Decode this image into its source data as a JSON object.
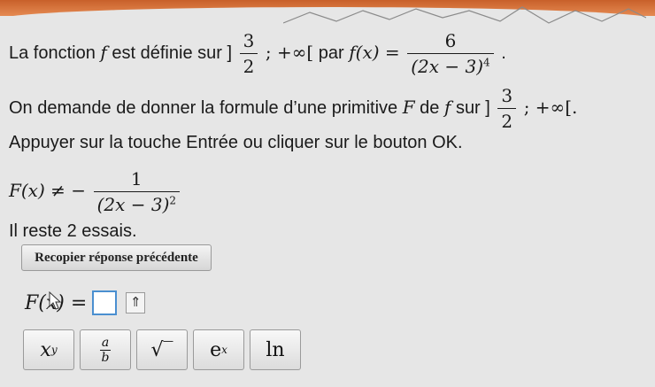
{
  "statement": {
    "prefix": "La fonction",
    "f": "f",
    "defined_on": "est définie sur ]",
    "interval_num": "3",
    "interval_den": "2",
    "interval_tail": "; +∞[",
    "par": "par",
    "fx": "f(x) =",
    "frac_num": "6",
    "frac_den": "(2x − 3)",
    "frac_den_exp": "4",
    "end": "."
  },
  "request": {
    "text": "On demande de donner la formule d’une primitive",
    "F": "F",
    "de": "de",
    "f": "f",
    "sur": "sur ]",
    "interval_num": "3",
    "interval_den": "2",
    "interval_tail": "; +∞[."
  },
  "instruction": "Appuyer sur la touche Entrée ou cliquer sur le bouton OK.",
  "wrong_answer": {
    "lhs": "F(x) ≠ −",
    "num": "1",
    "den": "(2x − 3)",
    "den_exp": "2"
  },
  "remaining": "Il reste 2 essais.",
  "recopy_button": "Recopier réponse précédente",
  "answer": {
    "label": "F(x) =",
    "value": "",
    "up_symbol": "⇑"
  },
  "keys": {
    "power_base": "x",
    "power_exp": "y",
    "frac_num": "a",
    "frac_den": "b",
    "sqrt": "√‾",
    "exp_base": "e",
    "exp_exp": "x",
    "ln": "ln"
  }
}
